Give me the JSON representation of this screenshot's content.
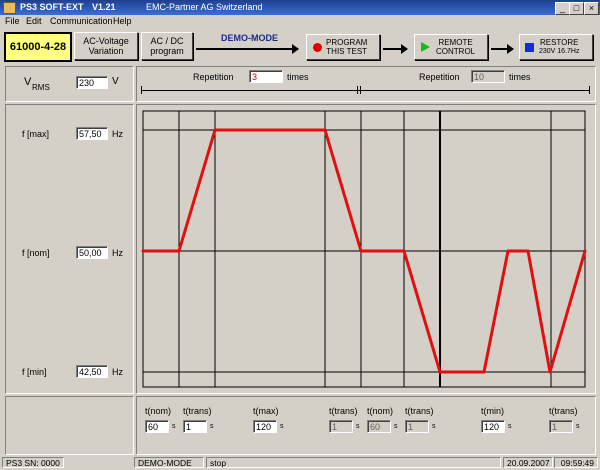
{
  "window": {
    "app_name": "PS3 SOFT-EXT",
    "version": "V1.21",
    "company": "EMC-Partner AG Switzerland",
    "min": "_",
    "max": "□",
    "close": "×"
  },
  "menu": [
    "File",
    "Edit",
    "Communication",
    "Help"
  ],
  "toolbar": {
    "standard": "61000-4-28",
    "ac_voltage": [
      "AC-Voltage",
      "Variation"
    ],
    "ac_dc": [
      "AC / DC",
      "program"
    ],
    "mode": "DEMO-MODE",
    "program": [
      "PROGRAM",
      "THIS TEST"
    ],
    "remote": [
      "REMOTE",
      "CONTROL"
    ],
    "restore": [
      "RESTORE",
      "230V 16.7Hz"
    ]
  },
  "vrms": {
    "label": "V",
    "sub": "RMS",
    "value": "230",
    "unit": "V"
  },
  "repetition": {
    "label1": "Repetition",
    "value1": "3",
    "unit1": "times",
    "label2": "Repetition",
    "value2": "10",
    "unit2": "times"
  },
  "levels": [
    {
      "label": "f [max]",
      "value": "57,50",
      "unit": "Hz"
    },
    {
      "label": "f [nom]",
      "value": "50,00",
      "unit": "Hz"
    },
    {
      "label": "f [min]",
      "value": "42,50",
      "unit": "Hz"
    }
  ],
  "chart_data": {
    "type": "line",
    "series": [
      {
        "x": [
          0,
          1,
          2,
          3,
          4,
          5,
          6,
          7,
          8,
          9,
          10,
          11
        ],
        "values": [
          50,
          50,
          57.5,
          57.5,
          50,
          50,
          42.5,
          42.5,
          50,
          50,
          42.5,
          50
        ]
      }
    ],
    "ylim": [
      42.5,
      57.5
    ],
    "color": "#e01010"
  },
  "times": [
    {
      "label": "t(nom)",
      "value": "60",
      "unit": "s",
      "enabled": true
    },
    {
      "label": "t(trans)",
      "value": "1",
      "unit": "s",
      "enabled": true
    },
    {
      "label": "t(max)",
      "value": "120",
      "unit": "s",
      "enabled": true
    },
    {
      "label": "t(trans)",
      "value": "1",
      "unit": "s",
      "enabled": false
    },
    {
      "label": "t(nom)",
      "value": "60",
      "unit": "s",
      "enabled": false
    },
    {
      "label": "t(trans)",
      "value": "1",
      "unit": "s",
      "enabled": false
    },
    {
      "label": "t(min)",
      "value": "120",
      "unit": "s",
      "enabled": true
    },
    {
      "label": "t(trans)",
      "value": "1",
      "unit": "s",
      "enabled": false
    }
  ],
  "status": {
    "device": "PS3  SN: 0000",
    "mode": "DEMO-MODE",
    "state": "stop",
    "date": "20.09.2007",
    "time": "09:59:49"
  },
  "colors": {
    "accent": "#1a2a8a",
    "program_dot": "#e00000",
    "remote_arrow": "#10c010",
    "restore_square": "#1030d0",
    "highlight": "#ffff80"
  }
}
